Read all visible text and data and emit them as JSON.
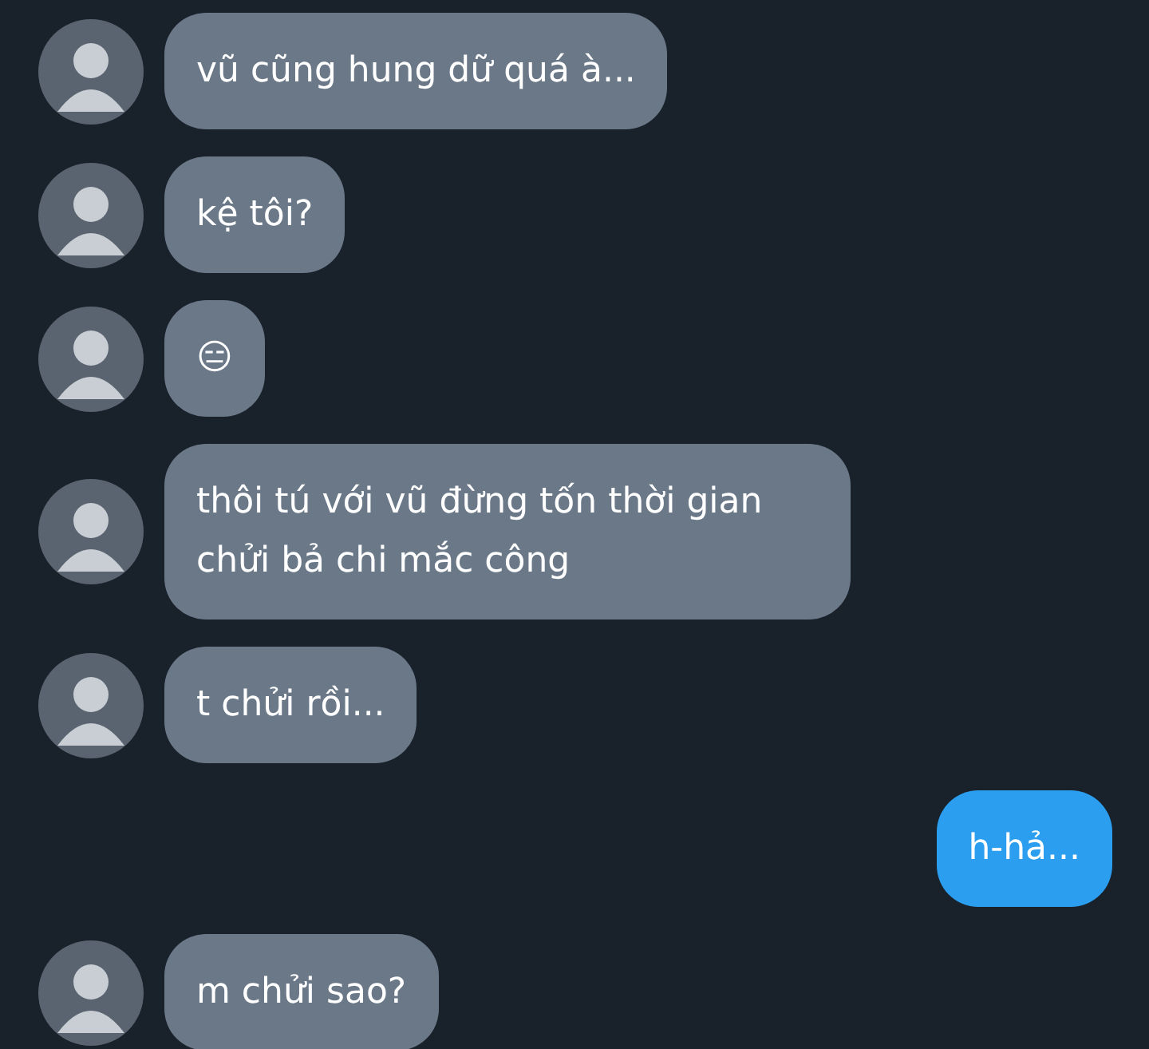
{
  "messages": [
    {
      "kind": "incoming",
      "text": "vũ cũng hung dữ quá à..."
    },
    {
      "kind": "incoming",
      "text": "kệ tôi?"
    },
    {
      "kind": "incoming",
      "text": "😑"
    },
    {
      "kind": "incoming",
      "text": "thôi tú với vũ đừng tốn thời gian chửi bả chi mắc công"
    },
    {
      "kind": "incoming",
      "text": "t chửi rồi..."
    },
    {
      "kind": "outgoing",
      "text": "h-hả..."
    },
    {
      "kind": "incoming",
      "text": "m chửi sao?"
    }
  ]
}
